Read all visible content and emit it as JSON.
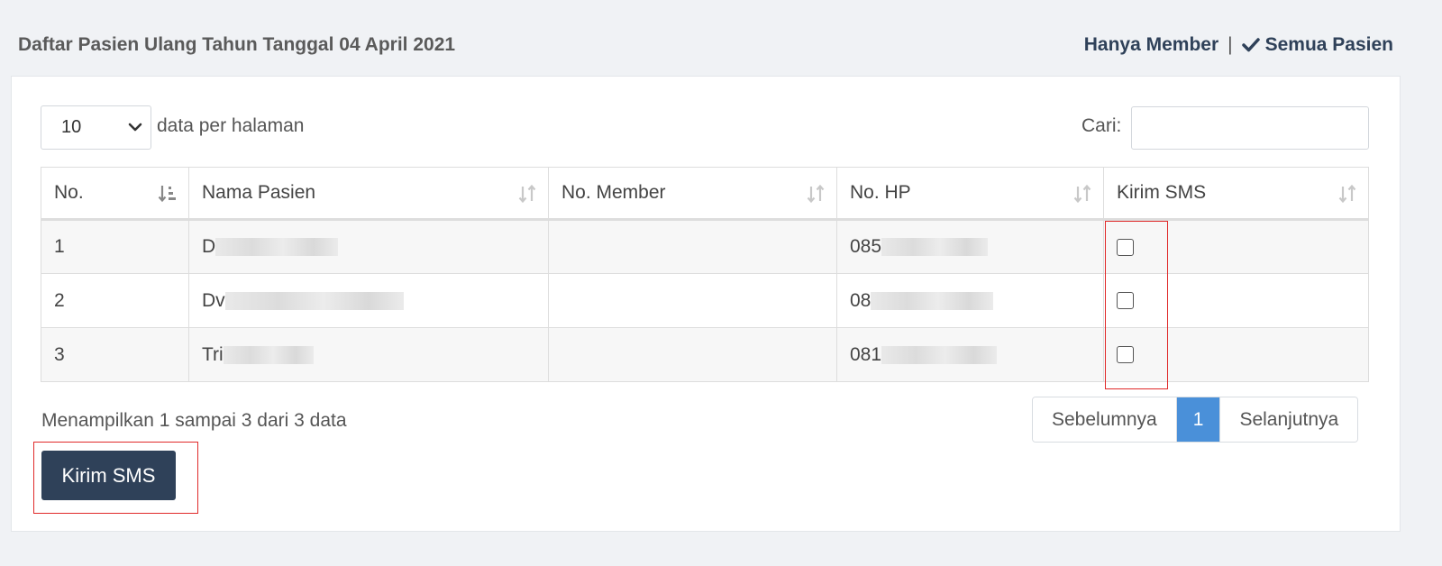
{
  "header": {
    "title": "Daftar Pasien Ulang Tahun Tanggal 04 April 2021",
    "filter_member": "Hanya Member",
    "separator": "|",
    "filter_all": "Semua Pasien"
  },
  "controls": {
    "page_length_value": "10",
    "page_length_label": "data per halaman",
    "search_label": "Cari:",
    "search_value": ""
  },
  "table": {
    "columns": [
      "No.",
      "Nama Pasien",
      "No. Member",
      "No. HP",
      "Kirim SMS"
    ],
    "rows": [
      {
        "no": "1",
        "name_visible": "D",
        "member": "",
        "phone_visible": "085",
        "sms_checked": false
      },
      {
        "no": "2",
        "name_visible": "Dv",
        "member": "",
        "phone_visible": "08",
        "sms_checked": false
      },
      {
        "no": "3",
        "name_visible": "Tri",
        "member": "",
        "phone_visible": "081",
        "sms_checked": false
      }
    ]
  },
  "footer": {
    "info": "Menampilkan 1 sampai 3 dari 3 data",
    "prev_label": "Sebelumnya",
    "current_page": "1",
    "next_label": "Selanjutnya",
    "send_button": "Kirim SMS"
  },
  "colors": {
    "primary_dark": "#2f4159",
    "pager_active": "#4a90d9",
    "highlight_red": "#e02a2a"
  },
  "icons": {
    "filter_check": "check-icon",
    "select_chevron": "chevron-down-icon",
    "sort_no": "sort-numeric-asc-icon",
    "sort_other": "sort-both-icon"
  }
}
